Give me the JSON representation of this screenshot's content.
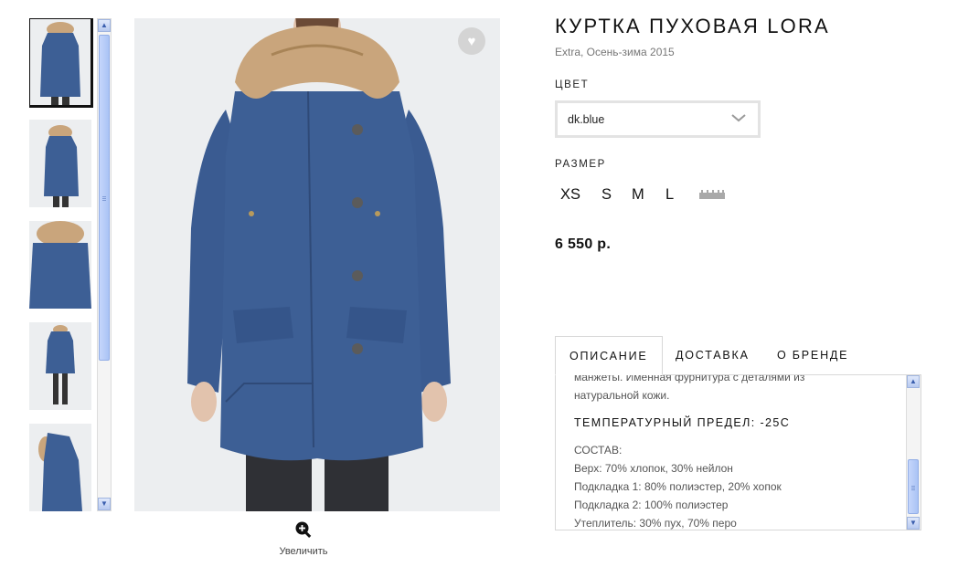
{
  "product": {
    "title": "КУРТКА ПУХОВАЯ LORA",
    "subtitle": "Extra, Осень-зима 2015",
    "color_label": "ЦВЕТ",
    "color_value": "dk.blue",
    "size_label": "РАЗМЕР",
    "sizes": [
      "XS",
      "S",
      "M",
      "L"
    ],
    "price": "6 550 р."
  },
  "gallery": {
    "zoom_label": "Увеличить",
    "thumbnail_count": 5,
    "active_thumbnail": 0
  },
  "tabs": [
    {
      "label": "ОПИСАНИЕ",
      "active": true
    },
    {
      "label": "ДОСТАВКА",
      "active": false
    },
    {
      "label": "О БРЕНДЕ",
      "active": false
    }
  ],
  "description": {
    "line1": "манжеты. Именная фурнитура с деталями из",
    "line2": "натуральной кожи.",
    "temperature": "ТЕМПЕРАТУРНЫЙ ПРЕДЕЛ: -25С",
    "composition_heading": "СОСТАВ:",
    "composition": [
      "Верх: 70% хлопок, 30% нейлон",
      "Подкладка 1: 80% полиэстер, 20% хопок",
      "Подкладка 2: 100% полиэстер",
      "Утеплитель: 30% пух, 70% перо"
    ]
  },
  "colors": {
    "jacket": "#3d5f95",
    "fur": "#c9a57c",
    "photo_bg": "#eceef0",
    "scrollbar": "#b7c9f0"
  }
}
